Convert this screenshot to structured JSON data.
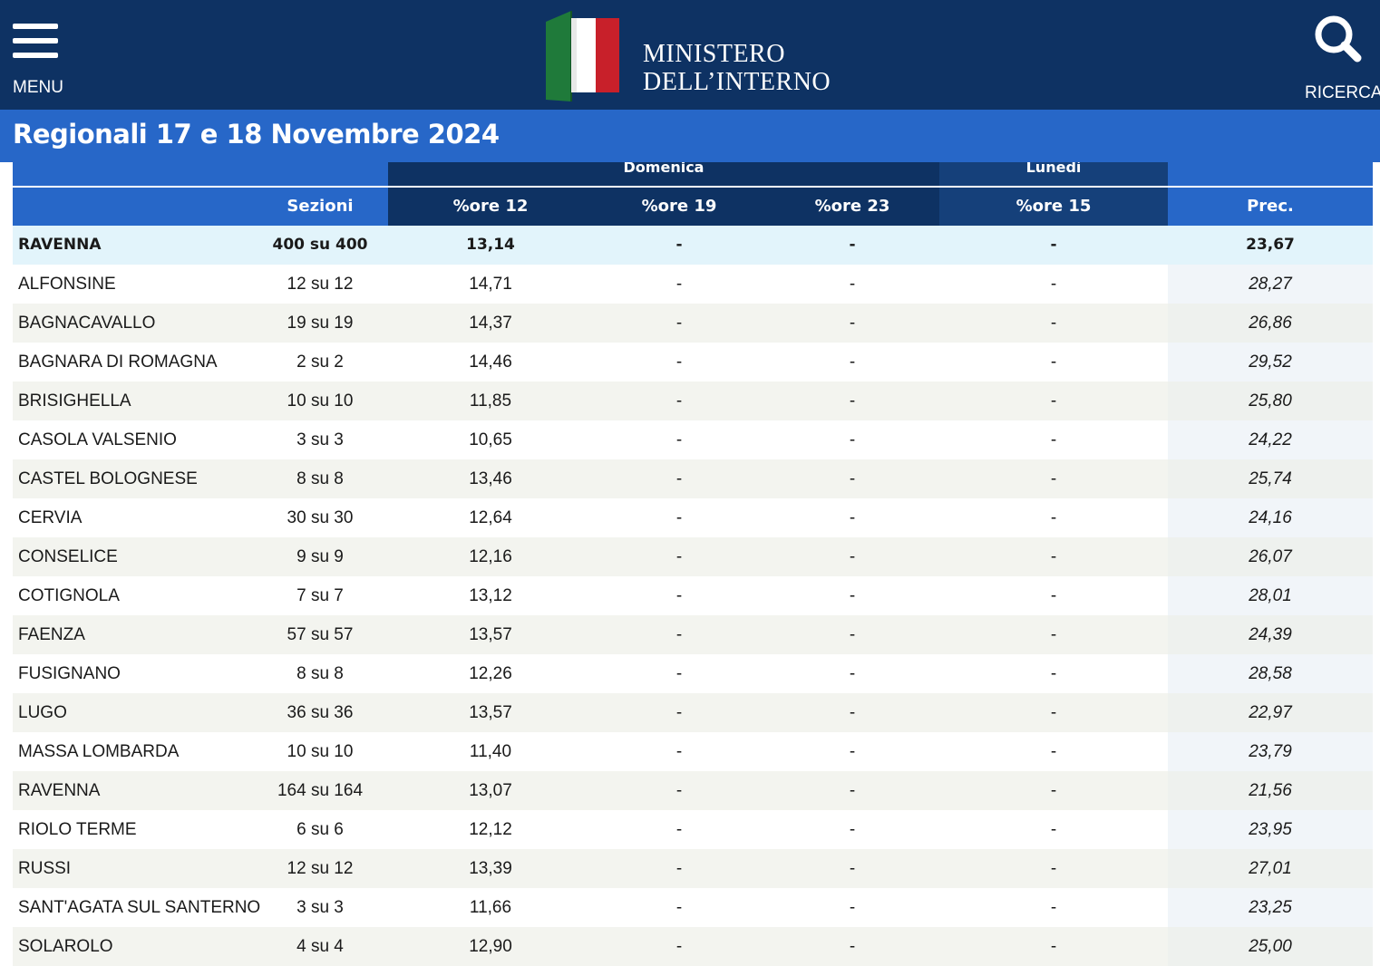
{
  "header": {
    "menu_label": "MENU",
    "logo_line1": "MINISTERO",
    "logo_line2": "DELL’INTERNO",
    "search_label": "RICERCA",
    "colors": {
      "bar": "#0e3263",
      "flag_green": "#1f7a3a",
      "flag_white": "#ffffff",
      "flag_red": "#c8202a"
    }
  },
  "title": "Regionali 17 e 18 Novembre 2024",
  "table": {
    "groups": {
      "domenica": "Domenica",
      "lunedi": "Lunedì"
    },
    "columns": {
      "sezioni": "Sezioni",
      "ore12": "%ore 12",
      "ore19": "%ore 19",
      "ore23": "%ore 23",
      "ore15": "%ore 15",
      "prec": "Prec."
    },
    "total": {
      "name": "RAVENNA",
      "sezioni": "400 su 400",
      "ore12": "13,14",
      "ore19": "-",
      "ore23": "-",
      "ore15": "-",
      "prec": "23,67"
    },
    "rows": [
      {
        "name": "ALFONSINE",
        "sezioni": "12 su 12",
        "ore12": "14,71",
        "ore19": "-",
        "ore23": "-",
        "ore15": "-",
        "prec": "28,27"
      },
      {
        "name": "BAGNACAVALLO",
        "sezioni": "19 su 19",
        "ore12": "14,37",
        "ore19": "-",
        "ore23": "-",
        "ore15": "-",
        "prec": "26,86"
      },
      {
        "name": "BAGNARA DI ROMAGNA",
        "sezioni": "2 su 2",
        "ore12": "14,46",
        "ore19": "-",
        "ore23": "-",
        "ore15": "-",
        "prec": "29,52"
      },
      {
        "name": "BRISIGHELLA",
        "sezioni": "10 su 10",
        "ore12": "11,85",
        "ore19": "-",
        "ore23": "-",
        "ore15": "-",
        "prec": "25,80"
      },
      {
        "name": "CASOLA VALSENIO",
        "sezioni": "3 su 3",
        "ore12": "10,65",
        "ore19": "-",
        "ore23": "-",
        "ore15": "-",
        "prec": "24,22"
      },
      {
        "name": "CASTEL BOLOGNESE",
        "sezioni": "8 su 8",
        "ore12": "13,46",
        "ore19": "-",
        "ore23": "-",
        "ore15": "-",
        "prec": "25,74"
      },
      {
        "name": "CERVIA",
        "sezioni": "30 su 30",
        "ore12": "12,64",
        "ore19": "-",
        "ore23": "-",
        "ore15": "-",
        "prec": "24,16"
      },
      {
        "name": "CONSELICE",
        "sezioni": "9 su 9",
        "ore12": "12,16",
        "ore19": "-",
        "ore23": "-",
        "ore15": "-",
        "prec": "26,07"
      },
      {
        "name": "COTIGNOLA",
        "sezioni": "7 su 7",
        "ore12": "13,12",
        "ore19": "-",
        "ore23": "-",
        "ore15": "-",
        "prec": "28,01"
      },
      {
        "name": "FAENZA",
        "sezioni": "57 su 57",
        "ore12": "13,57",
        "ore19": "-",
        "ore23": "-",
        "ore15": "-",
        "prec": "24,39"
      },
      {
        "name": "FUSIGNANO",
        "sezioni": "8 su 8",
        "ore12": "12,26",
        "ore19": "-",
        "ore23": "-",
        "ore15": "-",
        "prec": "28,58"
      },
      {
        "name": "LUGO",
        "sezioni": "36 su 36",
        "ore12": "13,57",
        "ore19": "-",
        "ore23": "-",
        "ore15": "-",
        "prec": "22,97"
      },
      {
        "name": "MASSA LOMBARDA",
        "sezioni": "10 su 10",
        "ore12": "11,40",
        "ore19": "-",
        "ore23": "-",
        "ore15": "-",
        "prec": "23,79"
      },
      {
        "name": "RAVENNA",
        "sezioni": "164 su 164",
        "ore12": "13,07",
        "ore19": "-",
        "ore23": "-",
        "ore15": "-",
        "prec": "21,56"
      },
      {
        "name": "RIOLO TERME",
        "sezioni": "6 su 6",
        "ore12": "12,12",
        "ore19": "-",
        "ore23": "-",
        "ore15": "-",
        "prec": "23,95"
      },
      {
        "name": "RUSSI",
        "sezioni": "12 su 12",
        "ore12": "13,39",
        "ore19": "-",
        "ore23": "-",
        "ore15": "-",
        "prec": "27,01"
      },
      {
        "name": "SANT'AGATA SUL SANTERNO",
        "sezioni": "3 su 3",
        "ore12": "11,66",
        "ore19": "-",
        "ore23": "-",
        "ore15": "-",
        "prec": "23,25"
      },
      {
        "name": "SOLAROLO",
        "sezioni": "4 su 4",
        "ore12": "12,90",
        "ore19": "-",
        "ore23": "-",
        "ore15": "-",
        "prec": "25,00"
      }
    ]
  }
}
